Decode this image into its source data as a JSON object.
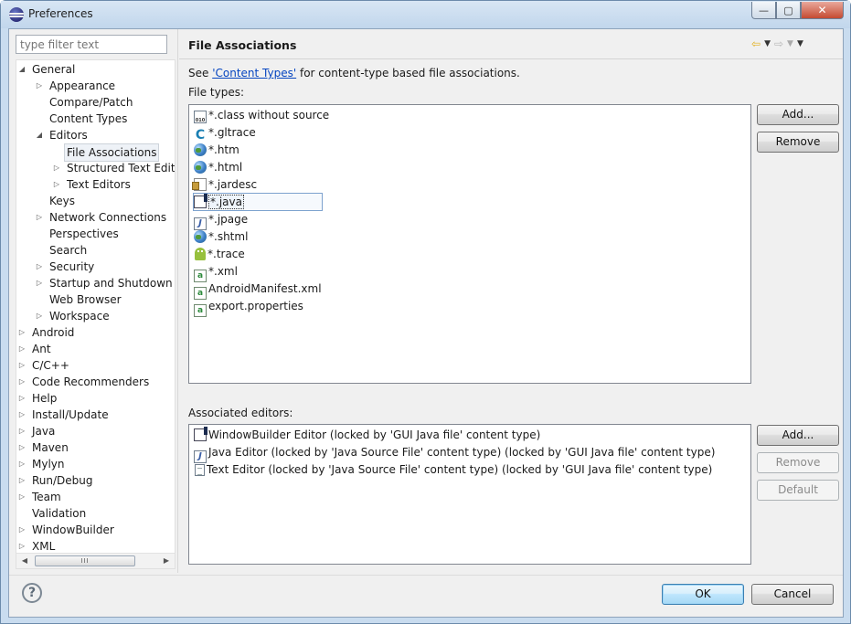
{
  "window": {
    "title": "Preferences",
    "minimize_glyph": "—",
    "maximize_glyph": "▢",
    "close_glyph": "✕"
  },
  "filter": {
    "placeholder": "type filter text"
  },
  "tree": [
    {
      "label": "General",
      "level": 0,
      "state": "expanded"
    },
    {
      "label": "Appearance",
      "level": 1,
      "state": "collapsed"
    },
    {
      "label": "Compare/Patch",
      "level": 1,
      "state": "leaf"
    },
    {
      "label": "Content Types",
      "level": 1,
      "state": "leaf"
    },
    {
      "label": "Editors",
      "level": 1,
      "state": "expanded"
    },
    {
      "label": "File Associations",
      "level": 2,
      "state": "leaf",
      "selected": true
    },
    {
      "label": "Structured Text Edit",
      "level": 2,
      "state": "collapsed"
    },
    {
      "label": "Text Editors",
      "level": 2,
      "state": "collapsed"
    },
    {
      "label": "Keys",
      "level": 1,
      "state": "leaf"
    },
    {
      "label": "Network Connections",
      "level": 1,
      "state": "collapsed"
    },
    {
      "label": "Perspectives",
      "level": 1,
      "state": "leaf"
    },
    {
      "label": "Search",
      "level": 1,
      "state": "leaf"
    },
    {
      "label": "Security",
      "level": 1,
      "state": "collapsed"
    },
    {
      "label": "Startup and Shutdown",
      "level": 1,
      "state": "collapsed"
    },
    {
      "label": "Web Browser",
      "level": 1,
      "state": "leaf"
    },
    {
      "label": "Workspace",
      "level": 1,
      "state": "collapsed"
    },
    {
      "label": "Android",
      "level": 0,
      "state": "collapsed"
    },
    {
      "label": "Ant",
      "level": 0,
      "state": "collapsed"
    },
    {
      "label": "C/C++",
      "level": 0,
      "state": "collapsed"
    },
    {
      "label": "Code Recommenders",
      "level": 0,
      "state": "collapsed"
    },
    {
      "label": "Help",
      "level": 0,
      "state": "collapsed"
    },
    {
      "label": "Install/Update",
      "level": 0,
      "state": "collapsed"
    },
    {
      "label": "Java",
      "level": 0,
      "state": "collapsed"
    },
    {
      "label": "Maven",
      "level": 0,
      "state": "collapsed"
    },
    {
      "label": "Mylyn",
      "level": 0,
      "state": "collapsed"
    },
    {
      "label": "Run/Debug",
      "level": 0,
      "state": "collapsed"
    },
    {
      "label": "Team",
      "level": 0,
      "state": "collapsed"
    },
    {
      "label": "Validation",
      "level": 0,
      "state": "leaf"
    },
    {
      "label": "WindowBuilder",
      "level": 0,
      "state": "collapsed"
    },
    {
      "label": "XML",
      "level": 0,
      "state": "collapsed"
    }
  ],
  "tree_glyphs": {
    "expanded": "◢",
    "collapsed": "▷",
    "left": "◀",
    "right": "▶",
    "thumb": "III"
  },
  "page": {
    "title": "File Associations",
    "nav": {
      "back": "⇦",
      "forward": "⇨",
      "dropdown": "▼",
      "menu": "▼"
    },
    "desc_prefix": "See ",
    "desc_link": "'Content Types'",
    "desc_suffix": " for content-type based file associations.",
    "file_types_label": "File types:",
    "associated_editors_label": "Associated editors:"
  },
  "file_types": [
    {
      "name": "*.class without source",
      "icon": "binary-file-icon"
    },
    {
      "name": "*.gltrace",
      "icon": "c-icon"
    },
    {
      "name": "*.htm",
      "icon": "globe-icon"
    },
    {
      "name": "*.html",
      "icon": "globe-icon"
    },
    {
      "name": "*.jardesc",
      "icon": "jar-icon"
    },
    {
      "name": "*.java",
      "icon": "windowbuilder-icon",
      "selected": true
    },
    {
      "name": "*.jpage",
      "icon": "java-file-icon"
    },
    {
      "name": "*.shtml",
      "icon": "globe-icon"
    },
    {
      "name": "*.trace",
      "icon": "android-icon"
    },
    {
      "name": "*.xml",
      "icon": "xml-file-icon"
    },
    {
      "name": "AndroidManifest.xml",
      "icon": "xml-file-icon"
    },
    {
      "name": "export.properties",
      "icon": "xml-file-icon"
    }
  ],
  "editors": [
    {
      "name": "WindowBuilder Editor (locked by 'GUI Java file' content type)",
      "icon": "windowbuilder-icon"
    },
    {
      "name": "Java Editor (locked by 'Java Source File' content type) (locked by 'GUI Java file' content type)",
      "icon": "java-file-icon"
    },
    {
      "name": "Text Editor (locked by 'Java Source File' content type) (locked by 'GUI Java file' content type)",
      "icon": "text-file-icon"
    }
  ],
  "buttons": {
    "file_add": "Add...",
    "file_remove": "Remove",
    "editor_add": "Add...",
    "editor_remove": "Remove",
    "editor_default": "Default",
    "ok": "OK",
    "cancel": "Cancel",
    "help": "?"
  },
  "colors": {
    "link": "#0645c0",
    "titlebar": "#c9dcef",
    "close_button": "#c54a31"
  }
}
